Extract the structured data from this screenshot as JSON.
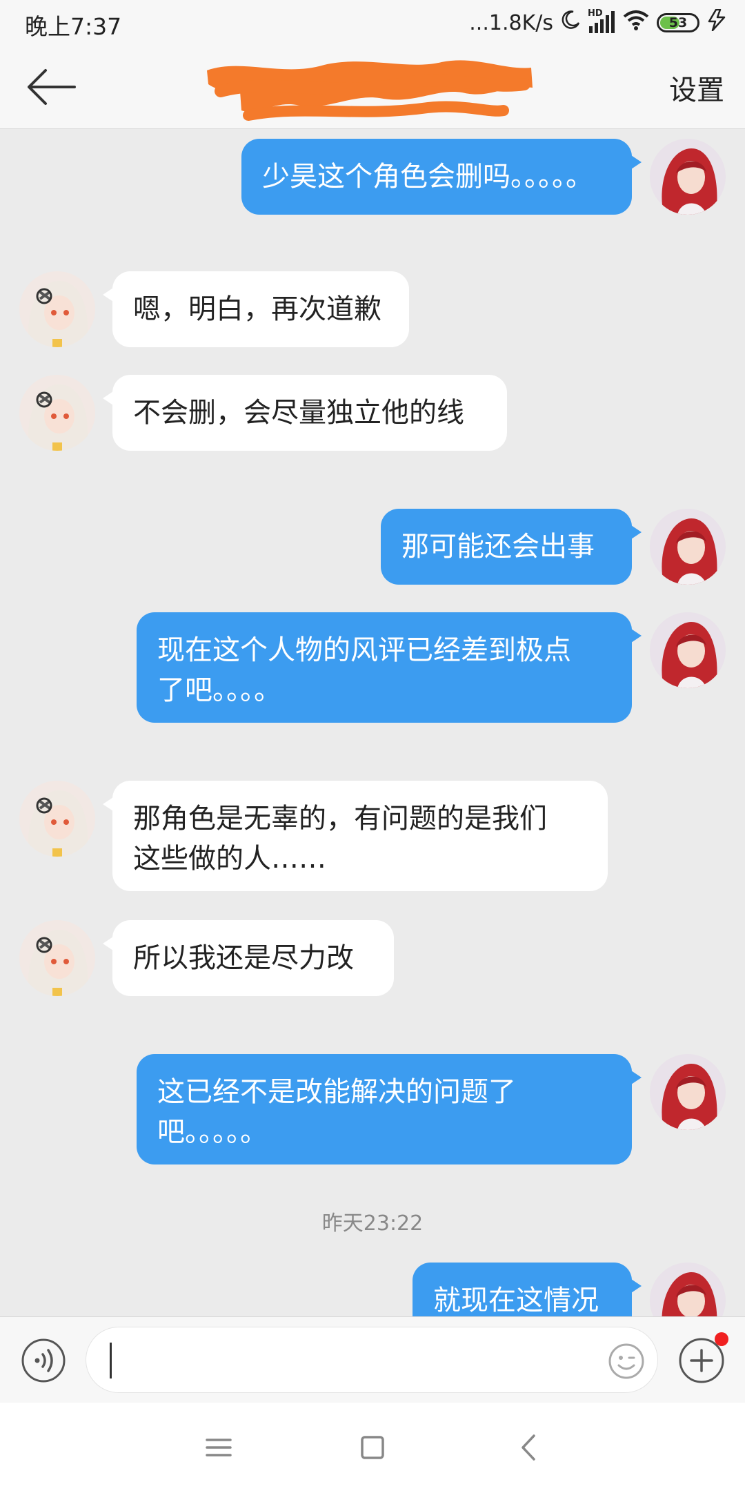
{
  "status_bar": {
    "time": "晚上7:37",
    "network_speed": "...1.8K/s",
    "hd_label": "HD",
    "battery_level": "53",
    "battery_percent": 0.53,
    "icons": [
      "moon-icon",
      "signal-icon",
      "wifi-icon",
      "battery-icon",
      "charging-icon"
    ]
  },
  "header": {
    "back_icon": "back-arrow-icon",
    "title_redacted": true,
    "settings_label": "设置"
  },
  "messages": [
    {
      "side": "out",
      "text": "少昊这个角色会删吗。。。。。"
    },
    {
      "side": "in",
      "text": "嗯，明白，再次道歉"
    },
    {
      "side": "in",
      "text": "不会删，会尽量独立他的线"
    },
    {
      "side": "out",
      "text": "那可能还会出事"
    },
    {
      "side": "out",
      "text": "现在这个人物的风评已经差到极点\n了吧。。。。"
    },
    {
      "side": "in",
      "text": "那角色是无辜的，有问题的是我们\n这些做的人……"
    },
    {
      "side": "in",
      "text": "所以我还是尽力改"
    },
    {
      "side": "out",
      "text": "这已经不是改能解决的问题了\n吧。。。。。"
    },
    {
      "side": "out",
      "text": "就现在这情况"
    }
  ],
  "timestamp": "昨天23:22",
  "input_bar": {
    "voice_icon": "voice-icon",
    "input_value": "",
    "emoji_icon": "emoji-icon",
    "plus_icon": "plus-icon",
    "has_notification_dot": true
  },
  "nav_bar": {
    "icons": [
      "menu-icon",
      "home-icon",
      "back-icon"
    ]
  },
  "colors": {
    "outgoing_bubble": "#3c9cf0",
    "incoming_bubble": "#ffffff",
    "background": "#ebebeb",
    "redaction": "#f47a2b"
  }
}
